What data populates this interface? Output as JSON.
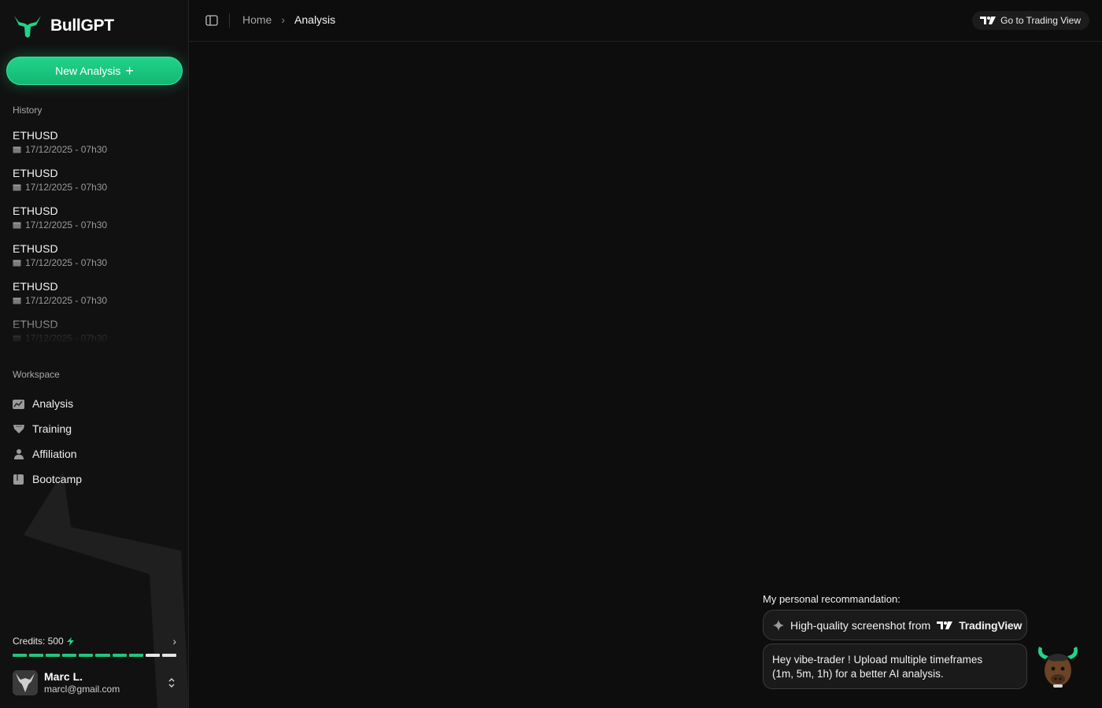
{
  "brand": {
    "name": "BullGPT",
    "accent": "#22d38a"
  },
  "sidebar": {
    "new_button_label": "New Analysis",
    "history_label": "History",
    "history": [
      {
        "title": "ETHUSD",
        "date": "17/12/2025 - 07h30"
      },
      {
        "title": "ETHUSD",
        "date": "17/12/2025 - 07h30"
      },
      {
        "title": "ETHUSD",
        "date": "17/12/2025 - 07h30"
      },
      {
        "title": "ETHUSD",
        "date": "17/12/2025 - 07h30"
      },
      {
        "title": "ETHUSD",
        "date": "17/12/2025 - 07h30"
      },
      {
        "title": "ETHUSD",
        "date": "17/12/2025 - 07h30"
      }
    ],
    "workspace_label": "Workspace",
    "workspace": [
      {
        "label": "Analysis",
        "icon": "chart-icon"
      },
      {
        "label": "Training",
        "icon": "shield-icon"
      },
      {
        "label": "Affiliation",
        "icon": "users-icon"
      },
      {
        "label": "Bootcamp",
        "icon": "book-icon"
      }
    ],
    "credits": {
      "label": "Credits: 500",
      "filled_fraction": 0.8
    },
    "user": {
      "name": "Marc L.",
      "email": "marcl@gmail.com"
    }
  },
  "header": {
    "breadcrumb": {
      "home": "Home",
      "current": "Analysis"
    },
    "tradingview_button": "Go to Trading View"
  },
  "recommendation": {
    "label": "My personal recommandation:",
    "pill_text": "High-quality screenshot from",
    "pill_brand": "TradingView",
    "message_line1": "Hey vibe-trader ! Upload multiple timeframes",
    "message_line2": "(1m, 5m, 1h) for a better AI analysis."
  }
}
